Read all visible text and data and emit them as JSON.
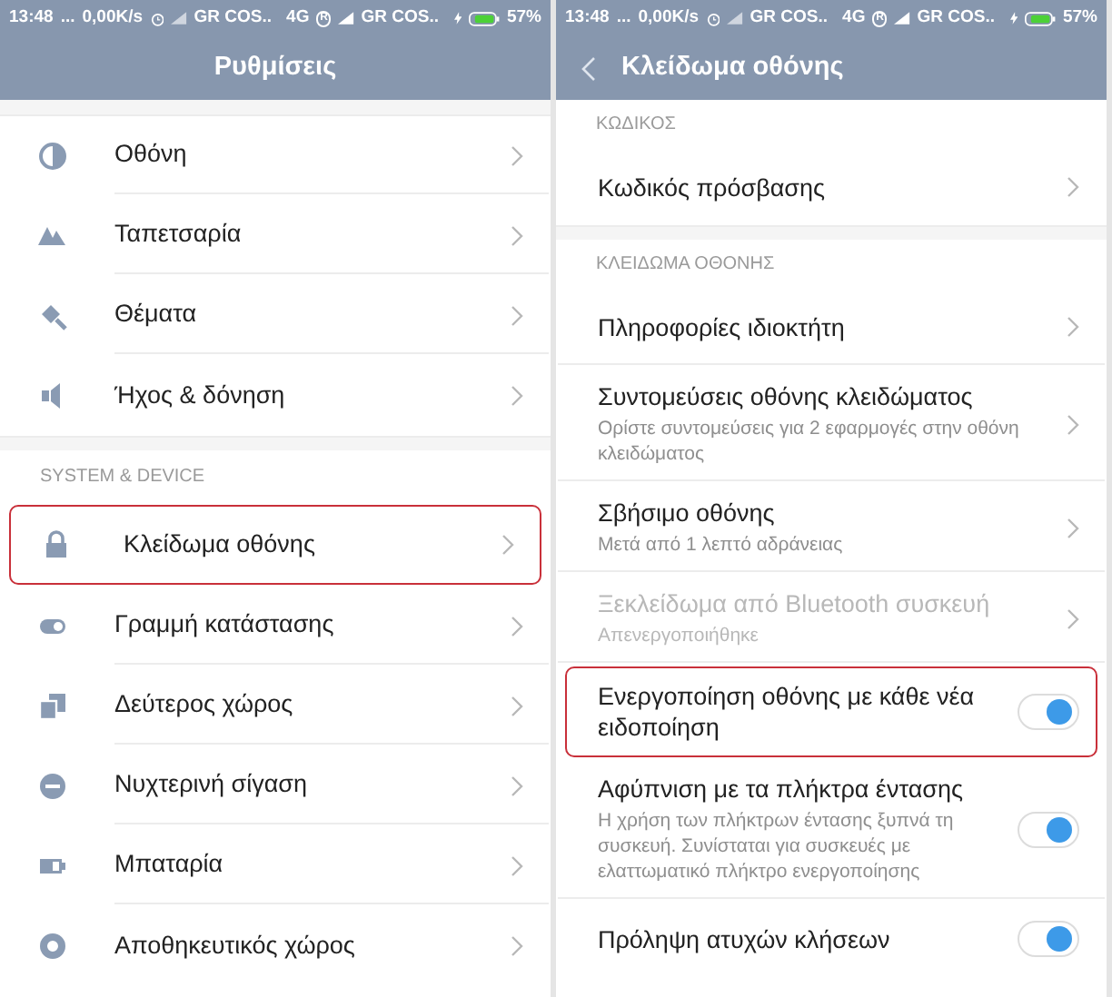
{
  "screens": [
    {
      "status_bar": {
        "time": "13:48",
        "dots": "...",
        "speed": "0,00K/s",
        "carrier_1": "GR COS..",
        "network": "4G",
        "roaming": "R",
        "carrier_2": "GR COS..",
        "battery": "57%"
      },
      "header": {
        "title": "Ρυθμίσεις",
        "back": false
      },
      "sections": [
        {
          "items": [
            {
              "label": "Οθόνη",
              "highlighted": false
            },
            {
              "label": "Ταπετσαρία",
              "highlighted": false
            },
            {
              "label": "Θέματα",
              "highlighted": false
            },
            {
              "label": "Ήχος & δόνηση",
              "highlighted": false
            }
          ]
        },
        {
          "title": "SYSTEM & DEVICE",
          "items": [
            {
              "label": "Κλείδωμα οθόνης",
              "highlighted": true
            },
            {
              "label": "Γραμμή κατάστασης",
              "highlighted": false
            },
            {
              "label": "Δεύτερος χώρος",
              "highlighted": false
            },
            {
              "label": "Νυχτερινή σίγαση",
              "highlighted": false
            },
            {
              "label": "Μπαταρία",
              "highlighted": false
            },
            {
              "label": "Αποθηκευτικός χώρος",
              "highlighted": false
            }
          ]
        }
      ]
    },
    {
      "status_bar": {
        "time": "13:48",
        "dots": "...",
        "speed": "0,00K/s",
        "carrier_1": "GR COS..",
        "network": "4G",
        "roaming": "R",
        "carrier_2": "GR COS..",
        "battery": "57%"
      },
      "header": {
        "title": "Κλείδωμα οθόνης",
        "back": true
      },
      "sections": [
        {
          "title": "ΚΩΔΙΚΟΣ",
          "items": [
            {
              "kind": "link",
              "label": "Κωδικός πρόσβασης",
              "highlighted": false,
              "disabled": false
            }
          ]
        },
        {
          "title": "ΚΛΕΙΔΩΜΑ ΟΘΟΝΗΣ",
          "items": [
            {
              "kind": "link",
              "label": "Πληροφορίες ιδιοκτήτη",
              "highlighted": false,
              "disabled": false
            },
            {
              "kind": "link",
              "label": "Συντομεύσεις οθόνης κλειδώματος",
              "subtitle": "Ορίστε συντομεύσεις για 2 εφαρμογές στην οθόνη κλειδώματος",
              "highlighted": false,
              "disabled": false
            },
            {
              "kind": "link",
              "label": "Σβήσιμο οθόνης",
              "subtitle": "Μετά από 1 λεπτό αδράνειας",
              "highlighted": false,
              "disabled": false
            },
            {
              "kind": "link",
              "label": "Ξεκλείδωμα από Bluetooth συσκευή",
              "subtitle": "Απενεργοποιήθηκε",
              "highlighted": false,
              "disabled": true
            },
            {
              "kind": "toggle",
              "label": "Ενεργοποίηση οθόνης με κάθε νέα ειδοποίηση",
              "highlighted": true,
              "disabled": false,
              "on": true
            },
            {
              "kind": "toggle",
              "label": "Αφύπνιση με τα πλήκτρα έντασης",
              "subtitle": "Η χρήση των πλήκτρων έντασης ξυπνά τη συσκευή. Συνίσταται για συσκευές με ελαττωματικό πλήκτρο ενεργοποίησης",
              "highlighted": false,
              "disabled": false,
              "on": true
            },
            {
              "kind": "toggle",
              "label": "Πρόληψη ατυχών κλήσεων",
              "highlighted": false,
              "disabled": false,
              "on": true
            }
          ]
        }
      ]
    }
  ]
}
